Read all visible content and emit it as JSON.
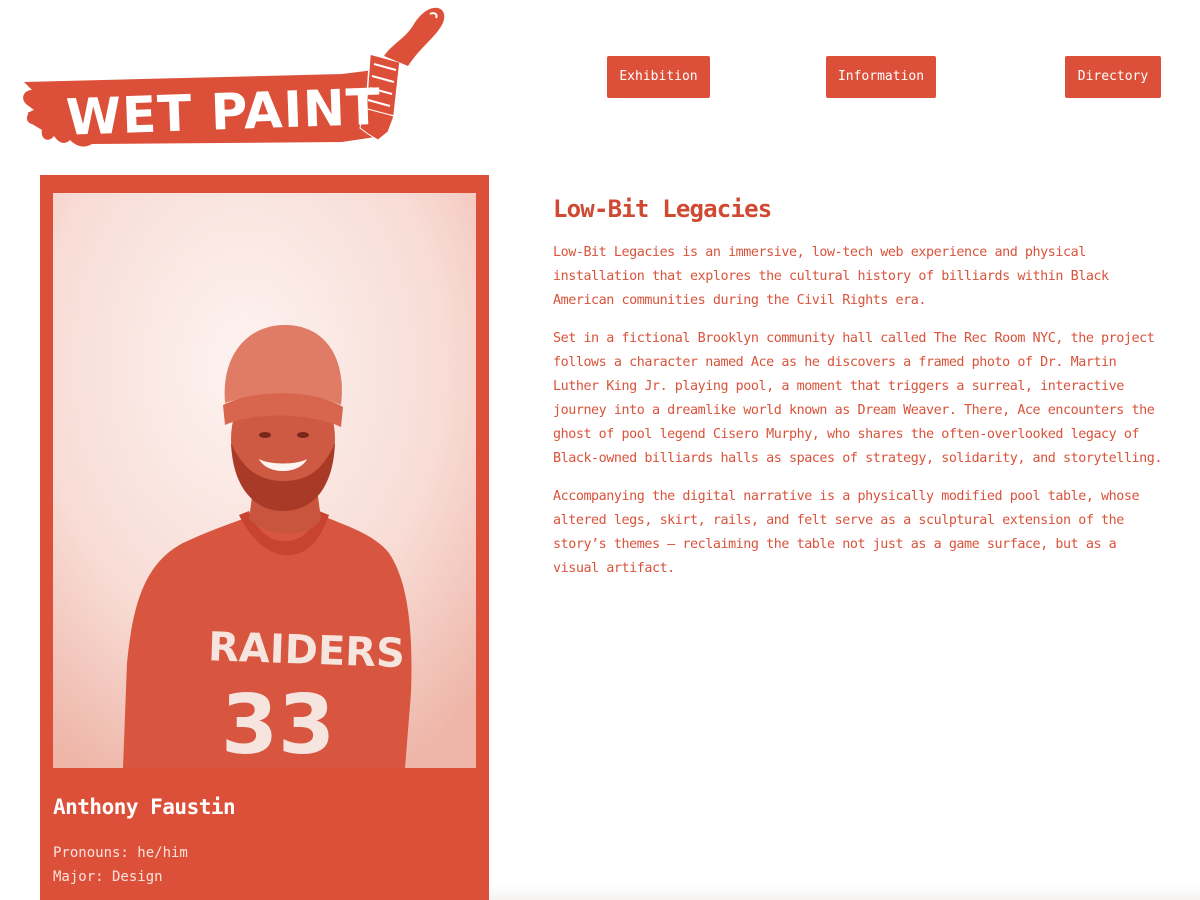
{
  "logo": {
    "text": "WET PAINT"
  },
  "nav": {
    "exhibition": "Exhibition",
    "information": "Information",
    "directory": "Directory"
  },
  "artist": {
    "name": "Anthony Faustin",
    "pronouns": "Pronouns: he/him",
    "major": "Major: Design",
    "shirt_text": "RAIDERS",
    "shirt_number": "33"
  },
  "project": {
    "title": "Low-Bit Legacies",
    "paragraphs": [
      "Low-Bit Legacies is an immersive, low-tech web experience and physical installation that explores the cultural history of billiards within Black American communities during the Civil Rights era.",
      "Set in a fictional Brooklyn community hall called The Rec Room NYC, the project follows a character named Ace as he discovers a framed photo of Dr. Martin Luther King Jr. playing pool, a moment that triggers a surreal, interactive journey into a dreamlike world known as Dream Weaver. There, Ace encounters the ghost of pool legend Cisero Murphy, who shares the often-overlooked legacy of Black-owned billiards halls as spaces of strategy, solidarity, and storytelling.",
      "Accompanying the digital narrative is a physically modified pool table, whose altered legs, skirt, rails, and felt serve as a sculptural extension of the story’s themes — reclaiming the table not just as a game surface, but as a visual artifact."
    ]
  },
  "colors": {
    "accent": "#dc5039",
    "text": "#d9533b",
    "background": "#ffffff"
  }
}
